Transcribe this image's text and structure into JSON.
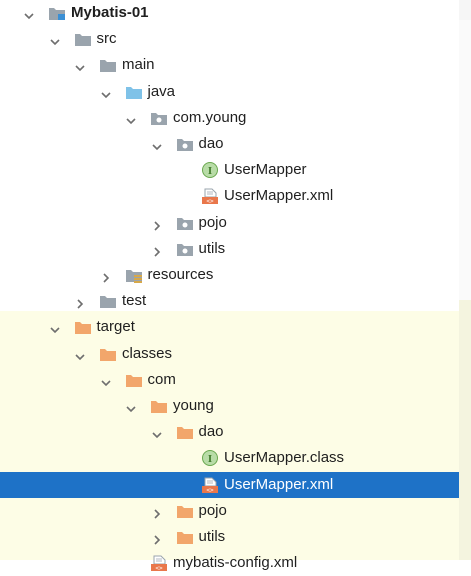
{
  "project_tree": {
    "items": [
      {
        "label": "Mybatis-01",
        "depth": 0,
        "expanded": true,
        "icon": "module-folder-icon"
      },
      {
        "label": "src",
        "depth": 1,
        "expanded": true,
        "icon": "folder-icon"
      },
      {
        "label": "main",
        "depth": 2,
        "expanded": true,
        "icon": "folder-icon"
      },
      {
        "label": "java",
        "depth": 3,
        "expanded": true,
        "icon": "source-folder-icon"
      },
      {
        "label": "com.young",
        "depth": 4,
        "expanded": true,
        "icon": "package-icon"
      },
      {
        "label": "dao",
        "depth": 5,
        "expanded": true,
        "icon": "package-icon"
      },
      {
        "label": "UserMapper",
        "depth": 6,
        "icon": "interface-icon"
      },
      {
        "label": "UserMapper.xml",
        "depth": 6,
        "icon": "xml-file-icon"
      },
      {
        "label": "pojo",
        "depth": 5,
        "expanded": false,
        "icon": "package-icon"
      },
      {
        "label": "utils",
        "depth": 5,
        "expanded": false,
        "icon": "package-icon"
      },
      {
        "label": "resources",
        "depth": 3,
        "expanded": false,
        "icon": "resources-folder-icon"
      },
      {
        "label": "test",
        "depth": 2,
        "expanded": false,
        "icon": "folder-icon"
      },
      {
        "label": "target",
        "depth": 1,
        "expanded": true,
        "icon": "excluded-folder-icon"
      },
      {
        "label": "classes",
        "depth": 2,
        "expanded": true,
        "icon": "excluded-folder-icon"
      },
      {
        "label": "com",
        "depth": 3,
        "expanded": true,
        "icon": "excluded-folder-icon"
      },
      {
        "label": "young",
        "depth": 4,
        "expanded": true,
        "icon": "excluded-folder-icon"
      },
      {
        "label": "dao",
        "depth": 5,
        "expanded": true,
        "icon": "excluded-folder-icon"
      },
      {
        "label": "UserMapper.class",
        "depth": 6,
        "icon": "interface-icon"
      },
      {
        "label": "UserMapper.xml",
        "depth": 6,
        "icon": "xml-file-icon",
        "selected": true
      },
      {
        "label": "pojo",
        "depth": 5,
        "expanded": false,
        "icon": "excluded-folder-icon"
      },
      {
        "label": "utils",
        "depth": 5,
        "expanded": false,
        "icon": "excluded-folder-icon"
      },
      {
        "label": "mybatis-config.xml",
        "depth": 4,
        "icon": "xml-file-icon"
      }
    ]
  },
  "colors": {
    "selection": "#1e72c7",
    "excluded_band": "#fdfde6",
    "folder_gray": "#9aa4ad",
    "source_folder_blue": "#7fc2e8",
    "excluded_folder_orange": "#f2a66b",
    "interface_green": "#6aa84f",
    "xml_orange": "#e9774b"
  }
}
